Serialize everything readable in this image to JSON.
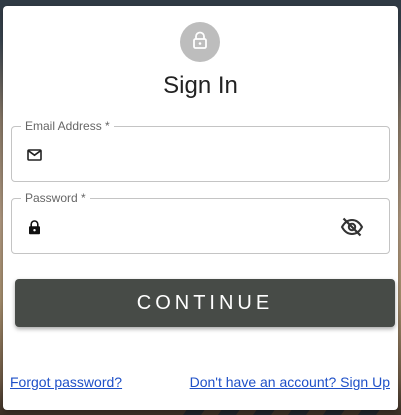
{
  "form": {
    "title": "Sign In",
    "email_label": "Email Address *",
    "email_value": "",
    "password_label": "Password *",
    "password_value": "",
    "submit_label": "CONTINUE",
    "forgot_link": "Forgot password?",
    "signup_link": "Don't have an account? Sign Up"
  },
  "icons": {
    "avatar": "lock-icon",
    "email": "mail-icon",
    "password": "lock-icon",
    "toggle": "eye-off-icon"
  },
  "colors": {
    "button_bg": "#474b47",
    "link": "#1e50c8",
    "avatar_bg": "#bdbdbd"
  }
}
